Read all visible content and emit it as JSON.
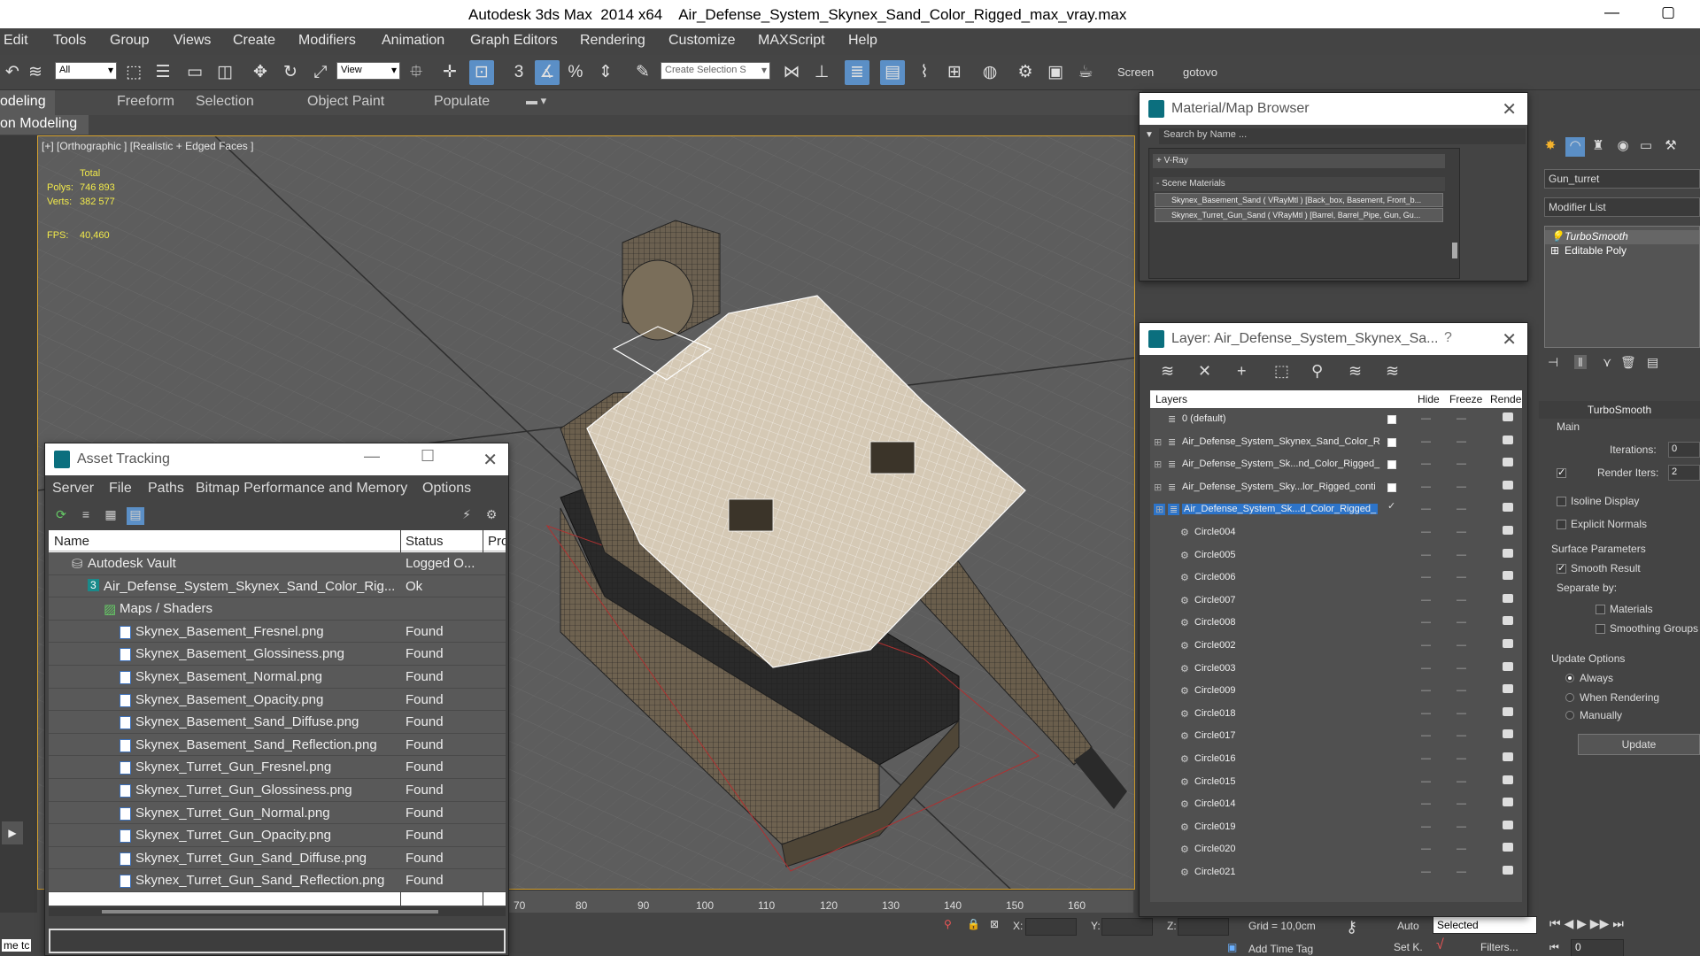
{
  "window": {
    "title": "Autodesk 3ds Max  2014 x64    Air_Defense_System_Skynex_Sand_Color_Rigged_max_vray.max",
    "minimize": "—",
    "restore": "▢"
  },
  "menubar": [
    "Edit",
    "Tools",
    "Group",
    "Views",
    "Create",
    "Modifiers",
    "Animation",
    "Graph Editors",
    "Rendering",
    "Customize",
    "MAXScript",
    "Help"
  ],
  "toolbar": {
    "filter_value": "All",
    "refcoord_value": "View",
    "selection_set_placeholder": "Create Selection S",
    "screen_label": "Screen",
    "gotovo_label": "gotovo",
    "snap_3": "3",
    "snap_percent": "%"
  },
  "ribbon": {
    "tabs": [
      "odeling",
      "Freeform",
      "Selection",
      "Object Paint",
      "Populate"
    ],
    "subtitle": "on Modeling"
  },
  "viewport": {
    "label": "[+] [Orthographic ] [Realistic + Edged Faces ]",
    "stats": {
      "total_label": "Total",
      "polys_label": "Polys:",
      "polys_value": "746 893",
      "verts_label": "Verts:",
      "verts_value": "382 577",
      "fps_label": "FPS:",
      "fps_value": "40,460"
    }
  },
  "ruler": [
    "70",
    "80",
    "90",
    "100",
    "110",
    "120",
    "130",
    "140",
    "150",
    "160"
  ],
  "statusbar": {
    "x_label": "X:",
    "y_label": "Y:",
    "z_label": "Z:",
    "grid": "Grid = 10,0cm",
    "auto": "Auto",
    "selected": "Selected",
    "add_time_tag": "Add Time Tag",
    "setk": "Set K.",
    "filters": "Filters...",
    "frame": "0",
    "left_text": "me tc"
  },
  "material_browser": {
    "title": "Material/Map Browser",
    "search_placeholder": "Search by Name ...",
    "vray_group": "+ V-Ray",
    "scene_group": "- Scene Materials",
    "items": [
      "Skynex_Basement_Sand  ( VRayMtl ) [Back_box, Basement, Front_b...",
      "Skynex_Turret_Gun_Sand  ( VRayMtl ) [Barrel, Barrel_Pipe, Gun, Gu..."
    ]
  },
  "asset_tracking": {
    "title": "Asset Tracking",
    "menu": [
      "Server",
      "File",
      "Paths",
      "Bitmap Performance and Memory",
      "Options"
    ],
    "columns": [
      "Name",
      "Status",
      "Pro"
    ],
    "rows": [
      {
        "name": "Autodesk Vault",
        "status": "Logged O..."
      },
      {
        "name": "Air_Defense_System_Skynex_Sand_Color_Rig...",
        "status": "Ok"
      },
      {
        "name": "Maps / Shaders",
        "status": ""
      },
      {
        "name": "Skynex_Basement_Fresnel.png",
        "status": "Found"
      },
      {
        "name": "Skynex_Basement_Glossiness.png",
        "status": "Found"
      },
      {
        "name": "Skynex_Basement_Normal.png",
        "status": "Found"
      },
      {
        "name": "Skynex_Basement_Opacity.png",
        "status": "Found"
      },
      {
        "name": "Skynex_Basement_Sand_Diffuse.png",
        "status": "Found"
      },
      {
        "name": "Skynex_Basement_Sand_Reflection.png",
        "status": "Found"
      },
      {
        "name": "Skynex_Turret_Gun_Fresnel.png",
        "status": "Found"
      },
      {
        "name": "Skynex_Turret_Gun_Glossiness.png",
        "status": "Found"
      },
      {
        "name": "Skynex_Turret_Gun_Normal.png",
        "status": "Found"
      },
      {
        "name": "Skynex_Turret_Gun_Opacity.png",
        "status": "Found"
      },
      {
        "name": "Skynex_Turret_Gun_Sand_Diffuse.png",
        "status": "Found"
      },
      {
        "name": "Skynex_Turret_Gun_Sand_Reflection.png",
        "status": "Found"
      }
    ]
  },
  "layers": {
    "title": "Layer: Air_Defense_System_Skynex_Sa...",
    "help": "?",
    "columns": [
      "Layers",
      "Hide",
      "Freeze",
      "Rende"
    ],
    "rows": [
      {
        "name": "0 (default)"
      },
      {
        "name": "Air_Defense_System_Skynex_Sand_Color_R"
      },
      {
        "name": "Air_Defense_System_Sk...nd_Color_Rigged_"
      },
      {
        "name": "Air_Defense_System_Sky...lor_Rigged_conti"
      },
      {
        "name": "Air_Defense_System_Sk...d_Color_Rigged_"
      },
      {
        "name": "Circle004"
      },
      {
        "name": "Circle005"
      },
      {
        "name": "Circle006"
      },
      {
        "name": "Circle007"
      },
      {
        "name": "Circle008"
      },
      {
        "name": "Circle002"
      },
      {
        "name": "Circle003"
      },
      {
        "name": "Circle009"
      },
      {
        "name": "Circle018"
      },
      {
        "name": "Circle017"
      },
      {
        "name": "Circle016"
      },
      {
        "name": "Circle015"
      },
      {
        "name": "Circle014"
      },
      {
        "name": "Circle019"
      },
      {
        "name": "Circle020"
      },
      {
        "name": "Circle021"
      }
    ]
  },
  "command_panel": {
    "object_name": "Gun_turret",
    "modifier_list": "Modifier List",
    "stack": [
      "TurboSmooth",
      "Editable Poly"
    ],
    "rollout_title": "TurboSmooth",
    "main_label": "Main",
    "iterations_label": "Iterations:",
    "iterations_value": "0",
    "render_iters_label": "Render Iters:",
    "render_iters_value": "2",
    "isoline": "Isoline Display",
    "explicit_normals": "Explicit Normals",
    "surface_params": "Surface Parameters",
    "smooth_result": "Smooth Result",
    "separate_by": "Separate by:",
    "materials": "Materials",
    "smoothing_groups": "Smoothing Groups",
    "update_options": "Update Options",
    "always": "Always",
    "when_rendering": "When Rendering",
    "manually": "Manually",
    "update_button": "Update"
  }
}
